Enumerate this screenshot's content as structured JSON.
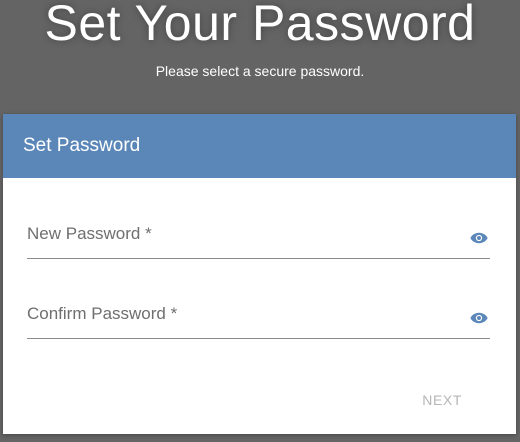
{
  "hero": {
    "title": "Set Your Password",
    "subtitle": "Please select a secure password."
  },
  "card": {
    "title": "Set Password",
    "header_color": "#5b87b8"
  },
  "fields": [
    {
      "label": "New Password *",
      "value": "",
      "icon": "eye-icon"
    },
    {
      "label": "Confirm Password *",
      "value": "",
      "icon": "eye-icon"
    }
  ],
  "actions": {
    "next_label": "NEXT"
  }
}
